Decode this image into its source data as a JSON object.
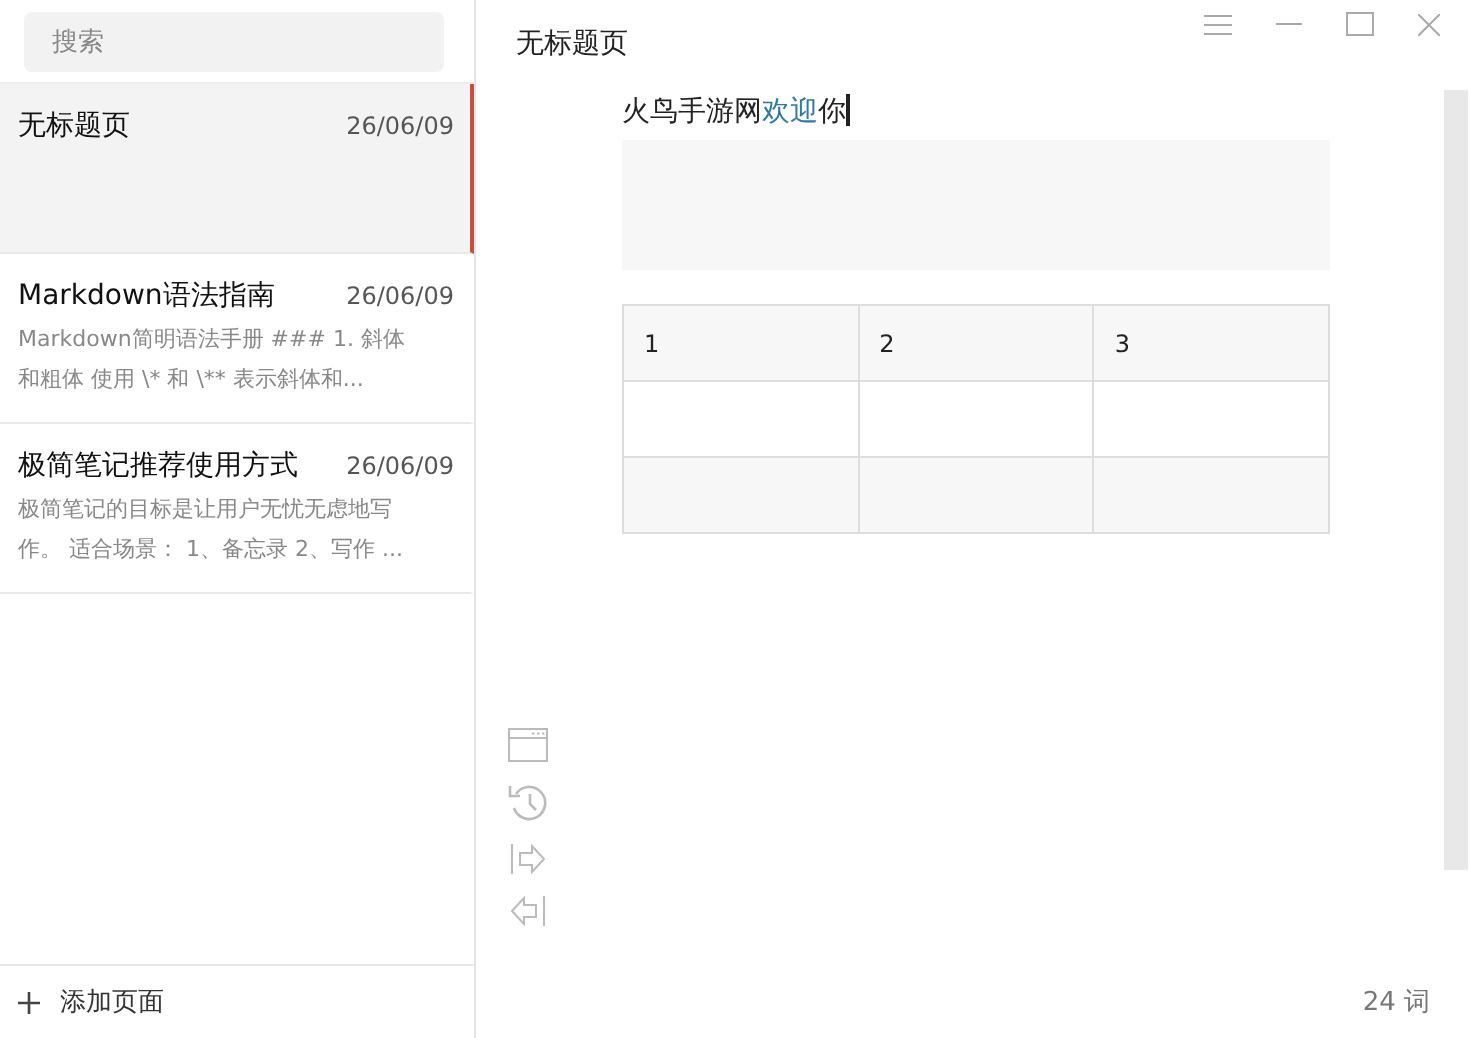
{
  "search": {
    "placeholder": "搜索"
  },
  "notes": [
    {
      "title": "无标题页",
      "date": "26/06/09",
      "selected": true
    },
    {
      "title": "Markdown语法指南",
      "date": "26/06/09",
      "preview": "Markdown简明语法手册  ### 1. 斜体和粗体  使用 \\* 和 \\** 表示斜体和...",
      "selected": false
    },
    {
      "title": "极简笔记推荐使用方式",
      "date": "26/06/09",
      "preview": "极简笔记的目标是让用户无忧无虑地写作。  适合场景：  1、备忘录  2、写作 ...",
      "selected": false
    }
  ],
  "add_page": "添加页面",
  "editor": {
    "title": "无标题页",
    "paragraph": [
      {
        "text": "火鸟手游网",
        "highlighted": false
      },
      {
        "text": "欢迎",
        "highlighted": true
      },
      {
        "text": "你",
        "highlighted": false
      }
    ],
    "table": {
      "rows": [
        {
          "cells": [
            "1",
            "2",
            "3"
          ]
        },
        {},
        {}
      ]
    },
    "word_count": "24 词"
  }
}
